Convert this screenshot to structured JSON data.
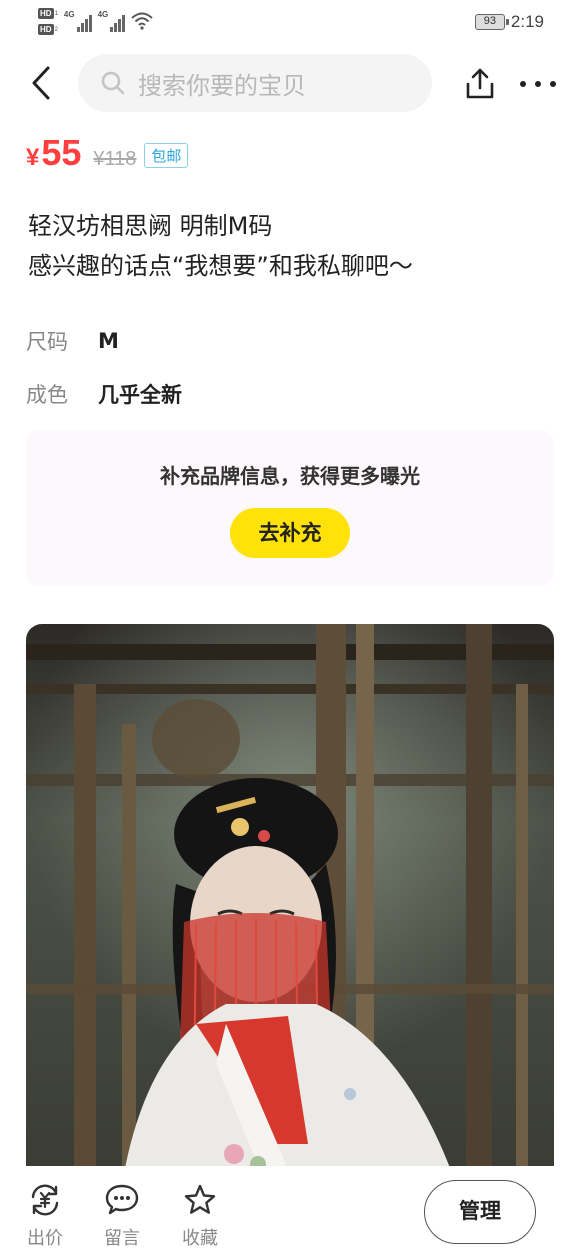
{
  "status_bar": {
    "sim1_label": "HD",
    "sim1_index": "1",
    "sim2_label": "HD",
    "sim2_index": "2",
    "network1": "4G",
    "network2": "4G",
    "battery": "93",
    "time": "2:19"
  },
  "header": {
    "search_placeholder": "搜索你要的宝贝"
  },
  "price": {
    "currency": "¥",
    "current": "55",
    "original": "¥118",
    "shipping_badge": "包邮"
  },
  "title": {
    "line1": "轻汉坊相思阙 明制M码",
    "line2": "感兴趣的话点“我想要”和我私聊吧～"
  },
  "attributes": [
    {
      "label": "尺码",
      "value": "M"
    },
    {
      "label": "成色",
      "value": "几乎全新"
    }
  ],
  "brand_card": {
    "text": "补充品牌信息，获得更多曝光",
    "button": "去补充",
    "button_color": "#ffe20a"
  },
  "bottom_bar": {
    "tabs": [
      {
        "label": "出价",
        "icon": "yuan-exchange-icon"
      },
      {
        "label": "留言",
        "icon": "chat-bubble-icon"
      },
      {
        "label": "收藏",
        "icon": "star-icon"
      }
    ],
    "manage": "管理"
  },
  "colors": {
    "price": "#ff3e3e",
    "badge": "#2aa7d8",
    "accent": "#ffe20a"
  }
}
